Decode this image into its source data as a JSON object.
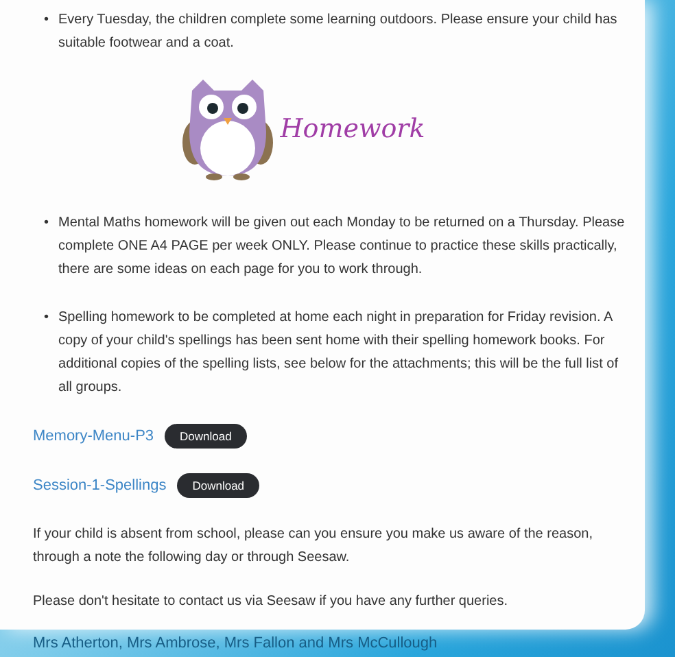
{
  "bullets_top": [
    {
      "marker": "•",
      "text": "Every Tuesday, the children complete some learning outdoors. Please ensure your child has suitable footwear and a coat."
    }
  ],
  "banner": {
    "title": "Homework"
  },
  "bullets": [
    {
      "marker": "•",
      "text": "Mental Maths homework will be given out each Monday to be returned on a Thursday. Please complete ONE A4 PAGE per week ONLY. Please continue to practice these skills practically, there are some ideas on each page for you to work through."
    },
    {
      "marker": "•",
      "text": "Spelling homework to be completed at home each night in preparation for Friday revision. A copy of your child's spellings has been sent home with their spelling homework books. For additional copies of the spelling lists, see below for the attachments; this will be the full list of all groups."
    }
  ],
  "attachments": [
    {
      "name": "Memory-Menu-P3",
      "button": "Download"
    },
    {
      "name": "Session-1-Spellings",
      "button": "Download"
    }
  ],
  "paragraphs": [
    "If your child is absent from school, please can you ensure you make us aware of the reason, through a note the following day or through Seesaw.",
    "Please don't hesitate to contact us via Seesaw if you have any further queries."
  ],
  "signature": "Mrs Atherton, Mrs Ambrose, Mrs Fallon and Mrs McCullough"
}
